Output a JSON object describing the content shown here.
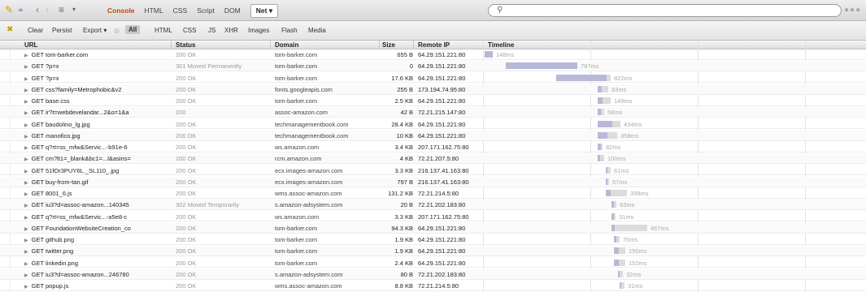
{
  "toolbar": {
    "tabs": [
      {
        "label": "Console"
      },
      {
        "label": "HTML"
      },
      {
        "label": "CSS"
      },
      {
        "label": "Script"
      },
      {
        "label": "DOM"
      },
      {
        "label": "Net ▾"
      }
    ],
    "search_placeholder": ""
  },
  "filters": {
    "clear": "Clear",
    "persist": "Persist",
    "export": "Export ▾",
    "items": [
      "All",
      "HTML",
      "CSS",
      "JS",
      "XHR",
      "Images",
      "Flash",
      "Media"
    ]
  },
  "columns": {
    "url": "URL",
    "status": "Status",
    "domain": "Domain",
    "size": "Size",
    "ip": "Remote IP",
    "timeline": "Timeline"
  },
  "requests": [
    {
      "url": "GET tom-barker.com",
      "status": "200 OK",
      "domain": "tom-barker.com",
      "size": "655 B",
      "ip": "64.29.151.221:80",
      "time": "148ms"
    },
    {
      "url": "GET ?p=x",
      "status": "301 Moved Permanently",
      "domain": "tom-barker.com",
      "size": "0",
      "ip": "64.29.151.221:80",
      "time": "787ms"
    },
    {
      "url": "GET ?p=x",
      "status": "200 OK",
      "domain": "tom-barker.com",
      "size": "17.6 KB",
      "ip": "64.29.151.221:80",
      "time": "822ms"
    },
    {
      "url": "GET css?family=Metrophobic&v2",
      "status": "200 OK",
      "domain": "fonts.googleapis.com",
      "size": "255 B",
      "ip": "173.194.74.95:80",
      "time": "83ms"
    },
    {
      "url": "GET base.css",
      "status": "200 OK",
      "domain": "tom-barker.com",
      "size": "2.5 KB",
      "ip": "64.29.151.221:80",
      "time": "149ms"
    },
    {
      "url": "GET ir?t=webdevelandar...2&o=1&a",
      "status": "200",
      "domain": "assoc-amazon.com",
      "size": "42 B",
      "ip": "72.21.215.147:80",
      "time": "58ms"
    },
    {
      "url": "GET baudolino_lg.jpg",
      "status": "200 OK",
      "domain": "techmanagementbook.com",
      "size": "28.4 KB",
      "ip": "64.29.151.221:80",
      "time": "434ms"
    },
    {
      "url": "GET manofico.jpg",
      "status": "200 OK",
      "domain": "techmanagementbook.com",
      "size": "10 KB",
      "ip": "64.29.151.221:80",
      "time": "358ms"
    },
    {
      "url": "GET q?rt=ss_mfw&Servic...-b91e-6",
      "status": "200 OK",
      "domain": "ws.amazon.com",
      "size": "3.4 KB",
      "ip": "207.171.162.75:80",
      "time": "82ms"
    },
    {
      "url": "GET cm?lt1=_blank&bc1=...l&asins=",
      "status": "200 OK",
      "domain": "rcm.amazon.com",
      "size": "4 KB",
      "ip": "72.21.207.5:80",
      "time": "100ms"
    },
    {
      "url": "GET 51fOr3PUY6L._SL110_.jpg",
      "status": "200 OK",
      "domain": "ecx.images-amazon.com",
      "size": "3.3 KB",
      "ip": "216.137.41.163:80",
      "time": "61ms"
    },
    {
      "url": "GET buy-from-tan.gif",
      "status": "200 OK",
      "domain": "ecx.images-amazon.com",
      "size": "797 B",
      "ip": "216.137.41.163:80",
      "time": "57ms"
    },
    {
      "url": "GET 8001_6.js",
      "status": "200 OK",
      "domain": "wms.assoc-amazon.com",
      "size": "131.2 KB",
      "ip": "72.21.214.5:80",
      "time": "398ms"
    },
    {
      "url": "GET iu3?d=assoc-amazon...140345",
      "status": "302 Moved Temporarily",
      "domain": "s.amazon-adsystem.com",
      "size": "20 B",
      "ip": "72.21.202.183:80",
      "time": "63ms"
    },
    {
      "url": "GET q?rt=ss_mfw&Servic...-a5e8-c",
      "status": "200 OK",
      "domain": "ws.amazon.com",
      "size": "3.3 KB",
      "ip": "207.171.162.75:80",
      "time": "31ms"
    },
    {
      "url": "GET FoundationWebsiteCreation_co",
      "status": "200 OK",
      "domain": "tom-barker.com",
      "size": "94.3 KB",
      "ip": "64.29.151.221:80",
      "time": "467ms"
    },
    {
      "url": "GET github.png",
      "status": "200 OK",
      "domain": "tom-barker.com",
      "size": "1.9 KB",
      "ip": "64.29.151.221:80",
      "time": "70ms"
    },
    {
      "url": "GET twitter.png",
      "status": "200 OK",
      "domain": "tom-barker.com",
      "size": "1.9 KB",
      "ip": "64.29.151.221:80",
      "time": "150ms"
    },
    {
      "url": "GET linkedin.png",
      "status": "200 OK",
      "domain": "tom-barker.com",
      "size": "2.4 KB",
      "ip": "64.29.151.221:80",
      "time": "152ms"
    },
    {
      "url": "GET iu3?d=assoc-amazon...246780",
      "status": "200 OK",
      "domain": "s.amazon-adsystem.com",
      "size": "80 B",
      "ip": "72.21.202.183:80",
      "time": "32ms"
    },
    {
      "url": "GET popup.js",
      "status": "200 OK",
      "domain": "wms.assoc-amazon.com",
      "size": "8.8 KB",
      "ip": "72.21.214.5:80",
      "time": "31ms"
    }
  ]
}
